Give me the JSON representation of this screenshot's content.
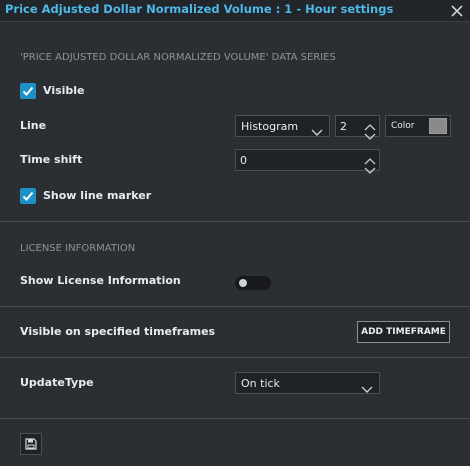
{
  "window": {
    "title": "Price Adjusted Dollar Normalized Volume : 1 - Hour settings",
    "close_icon": "close-icon",
    "accent_color": "#4fb8e6"
  },
  "data_series": {
    "heading": "'PRICE ADJUSTED DOLLAR NORMALIZED VOLUME' DATA SERIES",
    "visible": {
      "label": "Visible",
      "checked": true
    },
    "line": {
      "label": "Line",
      "style_value": "Histogram",
      "width_value": "2",
      "color_label": "Color",
      "color": "#8a8a8a"
    },
    "time_shift": {
      "label": "Time shift",
      "value": "0"
    },
    "show_line_marker": {
      "label": "Show line marker",
      "checked": true
    },
    "checkbox_color": "#1e90c8"
  },
  "license": {
    "heading": "LICENSE INFORMATION",
    "show_label": "Show License Information",
    "enabled": false
  },
  "timeframes": {
    "label": "Visible on specified timeframes",
    "add_button": "ADD TIMEFRAME"
  },
  "update_type": {
    "label": "UpdateType",
    "value": "On tick"
  },
  "footer": {
    "save_icon": "save-icon"
  }
}
